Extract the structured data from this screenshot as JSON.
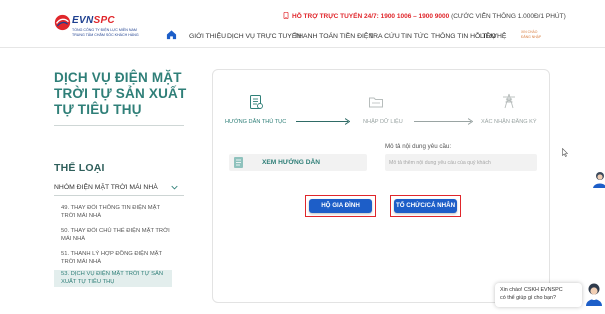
{
  "brand": {
    "evn": "EVN",
    "spc": "SPC",
    "subtitle_line1": "TỔNG CÔNG TY ĐIỆN LỰC MIỀN NAM",
    "subtitle_line2": "TRUNG TÂM CHĂM SÓC KHÁCH HÀNG"
  },
  "hotline": {
    "main": "HỖ TRỢ TRỰC TUYẾN 24/7: 1900 1006 – 1900 9000",
    "fee": "(CƯỚC VIỄN THÔNG 1.000Đ/1 PHÚT)"
  },
  "nav": {
    "items": [
      "GIỚI THIỆU",
      "DỊCH VỤ TRỰC TUYẾN",
      "THANH TOÁN TIỀN ĐIỆN",
      "TRA CỨU",
      "TIN TỨC",
      "THÔNG TIN HỖ TRỢ",
      "LIÊN HỆ"
    ],
    "login_line1": "XIN CHÀO",
    "login_line2": "ĐĂNG NHẬP"
  },
  "page": {
    "title": "DỊCH VỤ ĐIỆN MẶT TRỜI TỰ SẢN XUẤT TỰ TIÊU THỤ"
  },
  "category": {
    "title": "THỂ LOẠI",
    "group": "NHÓM ĐIỆN MẶT TRỜI MÁI NHÀ",
    "items": [
      "49. THAY ĐỔI THÔNG TIN ĐIỆN MẶT TRỜI MÁI NHÀ",
      "50. THAY ĐỔI CHỦ THỂ ĐIỆN MẶT TRỜI MÁI NHÀ",
      "51. THANH LÝ HỢP ĐỒNG ĐIỆN MẶT TRỜI MÁI NHÀ",
      "53. DỊCH VỤ ĐIỆN MẶT TRỜI TỰ SẢN XUẤT TỰ TIÊU THỤ"
    ]
  },
  "steps": [
    {
      "label": "HƯỚNG DẪN THỦ TỤC",
      "icon": "document-icon"
    },
    {
      "label": "NHẬP DỮ LIỆU",
      "icon": "folder-icon"
    },
    {
      "label": "XÁC NHẬN ĐĂNG KÝ",
      "icon": "transmission-tower-icon"
    }
  ],
  "guide": {
    "label": "XEM HƯỚNG DẪN"
  },
  "note": {
    "label": "Mô tả nội dung yêu cầu:",
    "placeholder": "Mô tả thêm nội dung yêu cầu của quý khách"
  },
  "buttons": {
    "household": "HỘ GIA ĐÌNH",
    "organization": "TỔ CHỨC/CÁ NHÂN"
  },
  "chat": {
    "line1": "Xin chào! CSKH EVNSPC",
    "line2": "có thể giúp gì cho bạn?"
  },
  "colors": {
    "brand_teal": "#2f7f78",
    "brand_blue": "#1d3f8f",
    "brand_red": "#e0262b",
    "button_blue": "#1d5ec8"
  }
}
